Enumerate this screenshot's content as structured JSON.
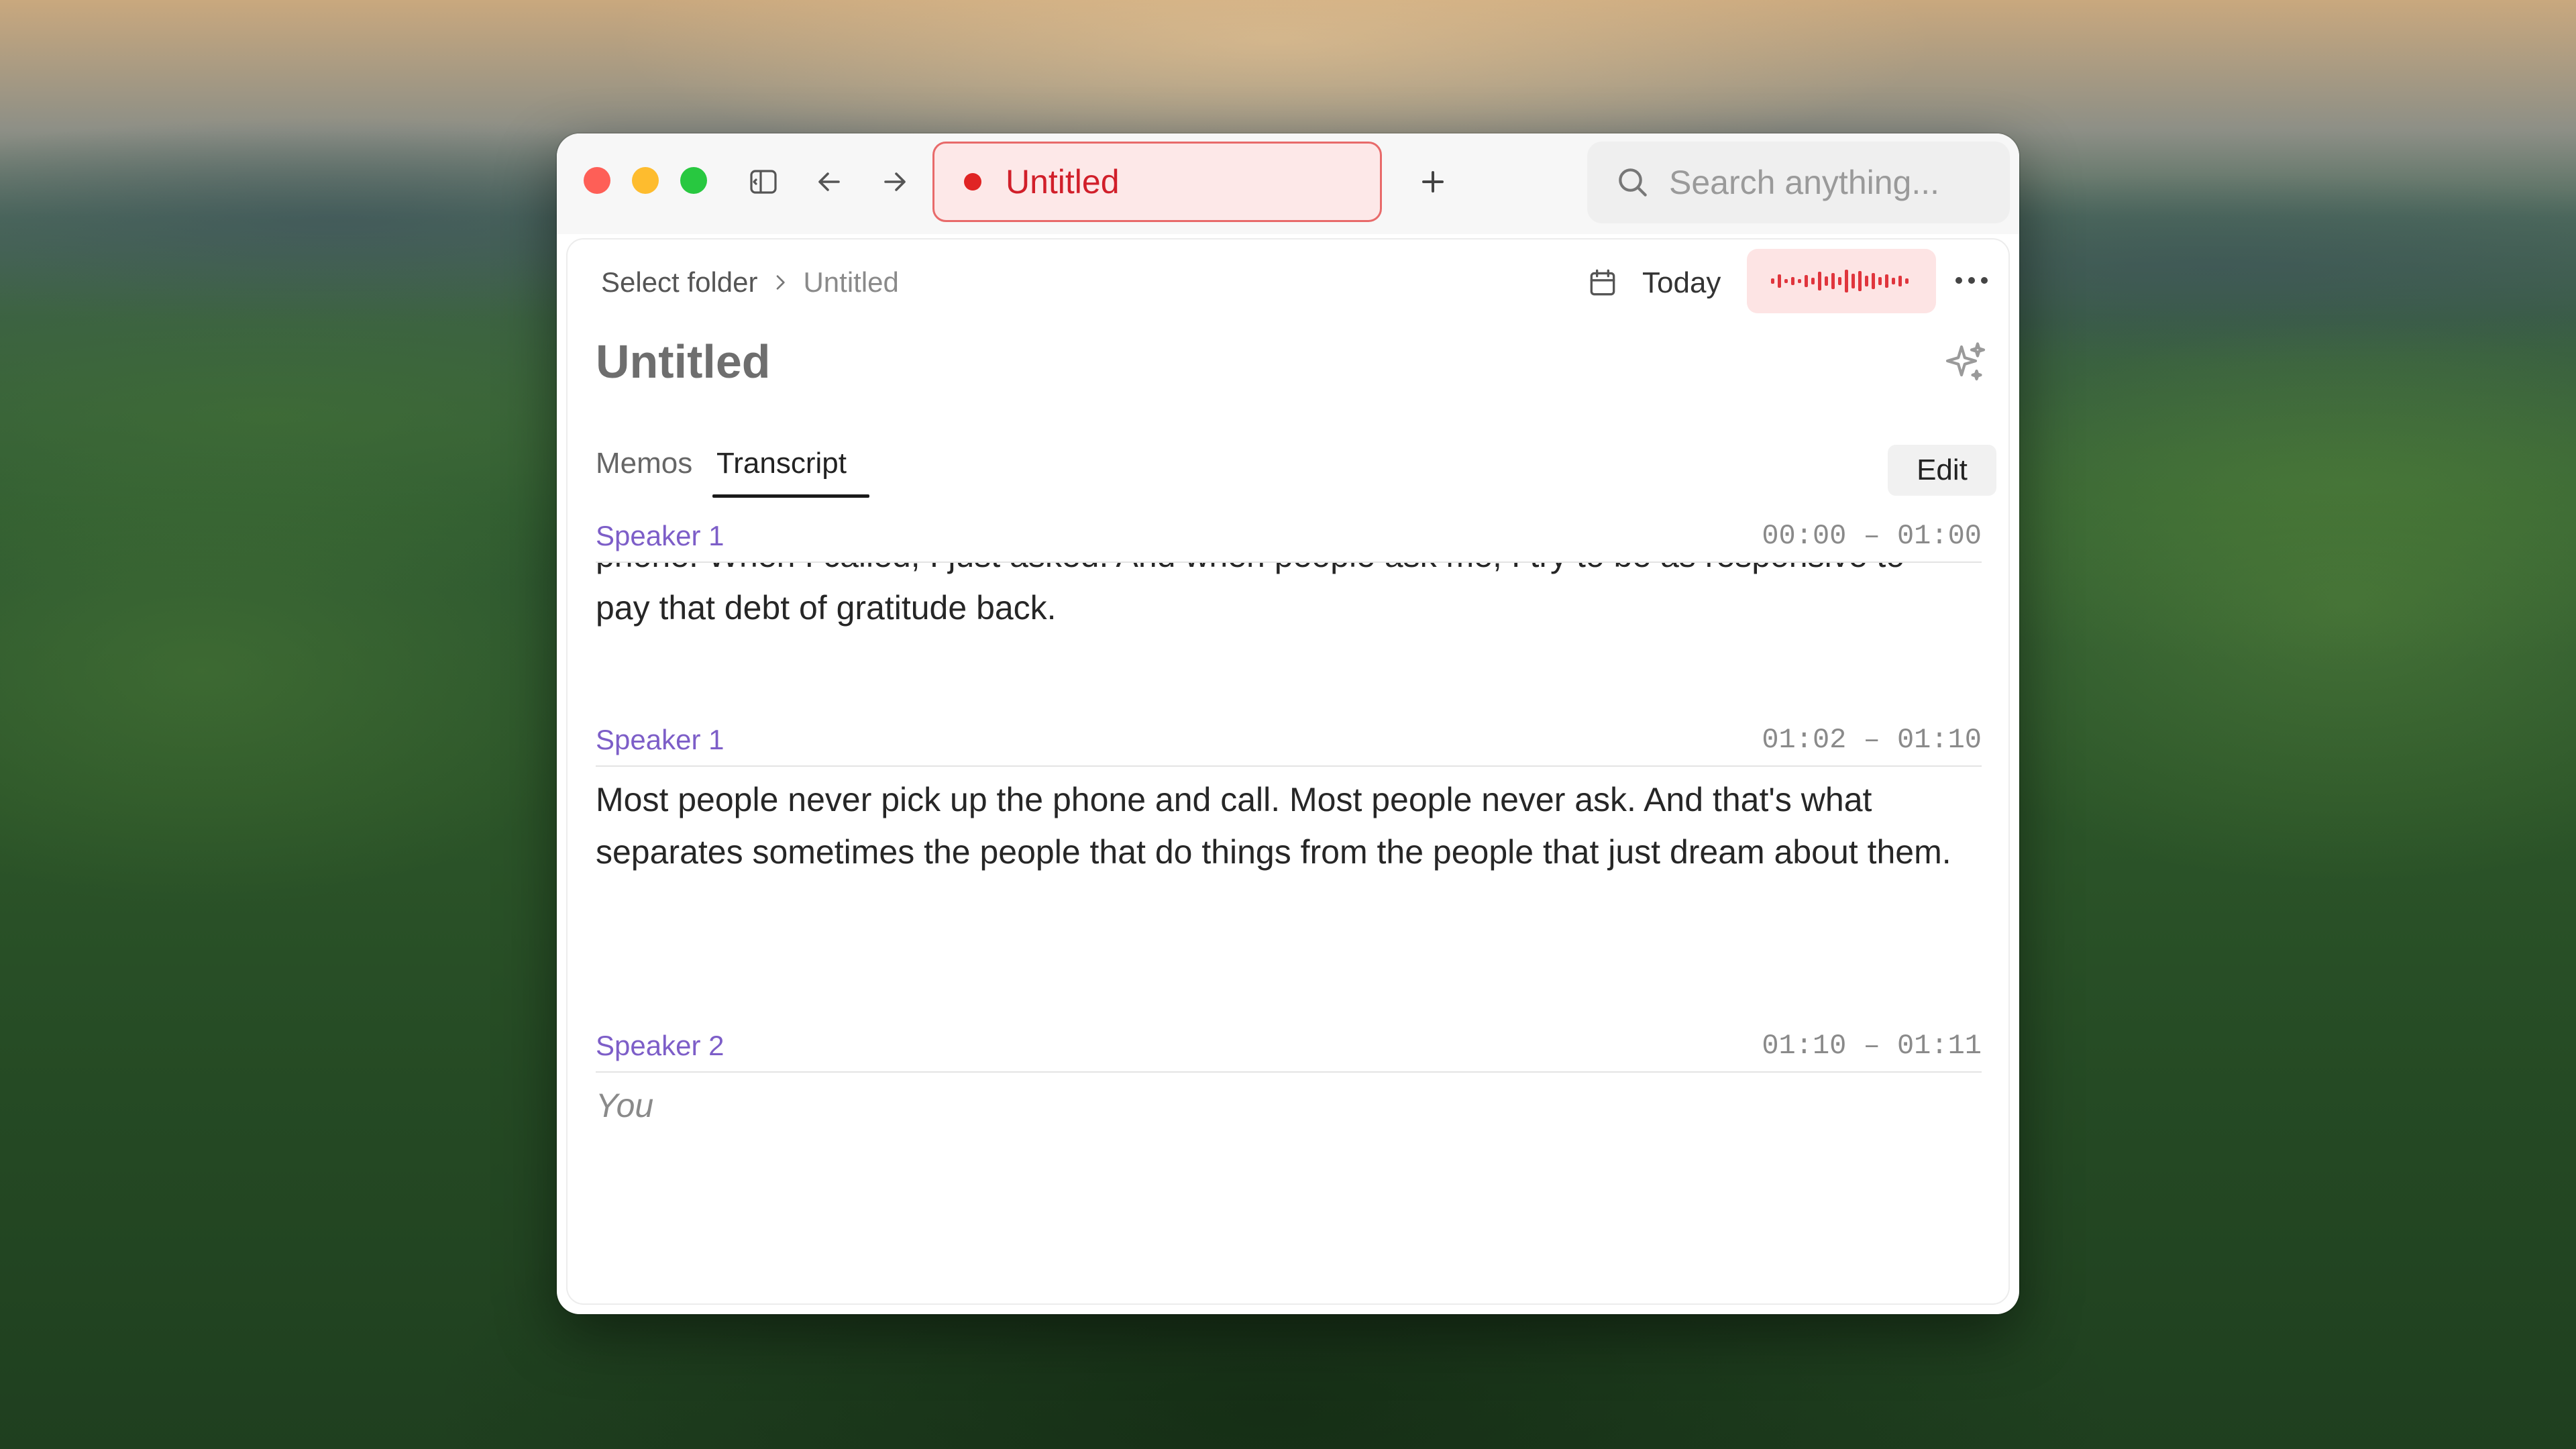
{
  "window": {
    "tab_title": "Untitled",
    "search_placeholder": "Search anything..."
  },
  "toolbar": {
    "breadcrumb": {
      "folder": "Select folder",
      "current": "Untitled"
    },
    "date_label": "Today"
  },
  "document": {
    "title": "Untitled",
    "tabs": [
      {
        "label": "Memos",
        "active": false
      },
      {
        "label": "Transcript",
        "active": true
      }
    ],
    "edit_label": "Edit"
  },
  "transcript": [
    {
      "speaker": "Speaker 1",
      "time": "00:00 – 01:00",
      "partial_line": "phone. When I called, I just asked. And when people ask me, I try to be as responsive to",
      "text": "pay that debt of gratitude back."
    },
    {
      "speaker": "Speaker 1",
      "time": "01:02 – 01:10",
      "text": "Most people never pick up the phone and call. Most people never ask. And that's what separates sometimes the people that do things from the people that just dream about them."
    },
    {
      "speaker": "Speaker 2",
      "time": "01:10 – 01:11",
      "text": "You"
    }
  ],
  "icons": {
    "sidebar": "sidebar-toggle-icon",
    "back": "arrow-left-icon",
    "forward": "arrow-right-icon",
    "new_tab": "plus-icon",
    "search": "search-icon",
    "calendar": "calendar-icon",
    "waveform": "waveform-icon",
    "more": "more-horizontal-icon",
    "ai": "sparkle-icon"
  },
  "colors": {
    "recording": "#e02424",
    "speaker": "#7d5ec8",
    "tab_bg": "#fde8e8"
  }
}
